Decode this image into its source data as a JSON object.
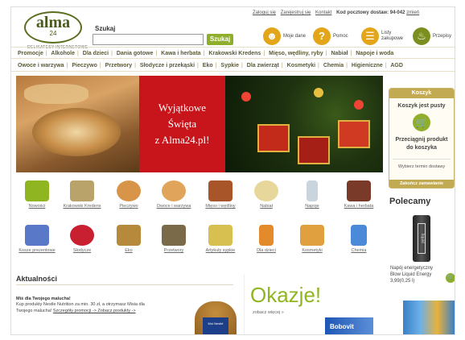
{
  "logo": {
    "name": "alma",
    "num": "24",
    "tag": "DELIKATESY INTERNETOWE"
  },
  "search": {
    "label": "Szukaj",
    "button": "Szukaj",
    "placeholder": ""
  },
  "toplinks": {
    "login": "Zaloguj się",
    "register": "Zarejestruj się",
    "contact": "Kontakt",
    "postal_label": "Kod pocztowy dostaw: 94-042",
    "change": "zmień"
  },
  "top_icons": [
    {
      "label": "Moje dane",
      "icon": "user-icon"
    },
    {
      "label": "Pomoc",
      "icon": "help-icon",
      "glyph": "?"
    },
    {
      "label": "Listy zakupowe",
      "icon": "list-icon"
    },
    {
      "label": "Przepisy",
      "icon": "recipe-icon"
    }
  ],
  "nav1": [
    "Promocje",
    "Alkohole",
    "Dla dzieci",
    "Dania gotowe",
    "Kawa i herbata",
    "Krakowski Kredens",
    "Mięso, wędliny, ryby",
    "Nabiał",
    "Napoje i woda"
  ],
  "nav2": [
    "Owoce i warzywa",
    "Pieczywo",
    "Przetwory",
    "Słodycze i przekąski",
    "Eko",
    "Sypkie",
    "Dla zwierząt",
    "Kosmetyki",
    "Chemia",
    "Higieniczne",
    "AGD"
  ],
  "hero": {
    "line1": "Wyjątkowe",
    "line2": "Święta",
    "line3": "z Alma24.pl!"
  },
  "cart": {
    "title": "Koszyk",
    "empty": "Koszyk jest pusty",
    "drag1": "Przeciągnij produkt",
    "drag2": "do koszyka",
    "term": "Wybierz termin dostawy",
    "finish": "Zakończ zamawianie"
  },
  "categories": [
    {
      "label": "Nowości",
      "color": "#8fb521"
    },
    {
      "label": "Krakowski Kredens",
      "color": "#b9a36b"
    },
    {
      "label": "Pieczywo",
      "color": "#d8954a"
    },
    {
      "label": "Owoce i warzywa",
      "color": "#e0a55a"
    },
    {
      "label": "Mięso i wędliny",
      "color": "#a8552a"
    },
    {
      "label": "Nabiał",
      "color": "#e8d79a"
    },
    {
      "label": "Napoje",
      "color": "#c9d4dc"
    },
    {
      "label": "Kawa i herbata",
      "color": "#7a3a2a"
    },
    {
      "label": "Kosze prezentowe",
      "color": "#5a78c8"
    },
    {
      "label": "Słodycze",
      "color": "#c82030"
    },
    {
      "label": "Eko",
      "color": "#b68a3a"
    },
    {
      "label": "Przetwory",
      "color": "#7a6a4a"
    },
    {
      "label": "Artykuły sypkie",
      "color": "#d8c050"
    },
    {
      "label": "Dla dzieci",
      "color": "#e38a2a"
    },
    {
      "label": "Kosmetyki",
      "color": "#e0a040"
    },
    {
      "label": "Chemia",
      "color": "#4a8ad8"
    }
  ],
  "polecamy": {
    "title": "Polecamy",
    "product_line1": "Napój energetyczny",
    "product_line2": "Blow Liquid Energy",
    "product_price": "3,99(0,25 l)",
    "can_text": "liquid"
  },
  "news": {
    "heading": "Aktualności",
    "title": "Miś dla Twojego malucha!",
    "text1": "Kup produkty Nestle Nutrition za min. 30 zł, a otrzymasz Misia dla",
    "text2": "Twojego malucha!",
    "link": "Szczegóły promocji -> Zobacz produkty ->",
    "bear_shirt": "Moi Nestlé"
  },
  "okazje": {
    "title": "Okazje!",
    "more": "zobacz więcej »",
    "product": "Bobovit"
  }
}
